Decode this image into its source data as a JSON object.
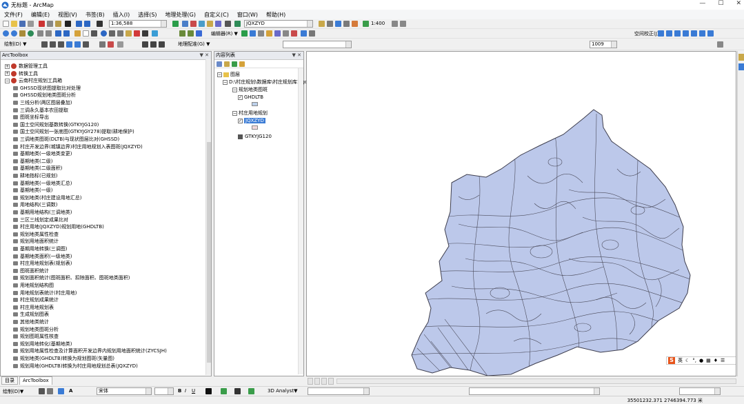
{
  "window": {
    "title": "无标题 - ArcMap",
    "controls": [
      "—",
      "☐",
      "✕"
    ]
  },
  "menu": [
    "文件(F)",
    "编辑(E)",
    "视图(V)",
    "书签(B)",
    "插入(I)",
    "选择(S)",
    "地理处理(G)",
    "自定义(C)",
    "窗口(W)",
    "帮助(H)"
  ],
  "toolbar": {
    "scale": "1:36,588",
    "layer": "JQXZYD",
    "zoom_percent": "1:400",
    "draw_label": "绘制(D) ▼",
    "editor_label": "编辑器(R) ▼",
    "georef_label": "地理配准(G) ▼",
    "spatial_adjust": "空间校正(J) ▼",
    "georef_layer": "",
    "tool_dd": "1009"
  },
  "arctoolbox": {
    "header": "ArcToolbox",
    "items": [
      {
        "level": 0,
        "kind": "toolbox",
        "label": "数据管理工具"
      },
      {
        "level": 0,
        "kind": "toolbox",
        "label": "转换工具"
      },
      {
        "level": 0,
        "kind": "toolbox",
        "label": "云南村庄规划工具箱"
      },
      {
        "level": 1,
        "kind": "tool",
        "label": "GHSSD现状图提取比对处理"
      },
      {
        "level": 1,
        "kind": "tool",
        "label": "GHSSD规划地类图斑分析"
      },
      {
        "level": 1,
        "kind": "tool",
        "label": "三线分析(两区图层叠加)"
      },
      {
        "level": 1,
        "kind": "tool",
        "label": "三调永久基本农田提取"
      },
      {
        "level": 1,
        "kind": "tool",
        "label": "图斑坐标导出"
      },
      {
        "level": 1,
        "kind": "tool",
        "label": "国土空间规划基数转换(GTKYJG120)"
      },
      {
        "level": 1,
        "kind": "tool",
        "label": "国土空间规划一张底图(GTKYJGY278)提取(耕地保护)"
      },
      {
        "level": 1,
        "kind": "tool",
        "label": "三调地类图斑(DLTB)与现状图层比对(GHSSD)"
      },
      {
        "level": 1,
        "kind": "tool",
        "label": "村庄开发边界(城镇边界)村庄用地规划入表图斑(JQXZYD)"
      },
      {
        "level": 1,
        "kind": "tool",
        "label": "基期地类(一级地类变更)"
      },
      {
        "level": 1,
        "kind": "tool",
        "label": "基期地类(二级)"
      },
      {
        "level": 1,
        "kind": "tool",
        "label": "基期地类(二级面积)"
      },
      {
        "level": 1,
        "kind": "tool",
        "label": "耕地指标(已规划)"
      },
      {
        "level": 1,
        "kind": "tool",
        "label": "基期地类(一级地类汇总)"
      },
      {
        "level": 1,
        "kind": "tool",
        "label": "基期地类(一级)"
      },
      {
        "level": 1,
        "kind": "tool",
        "label": "规划地类(村庄建设用地汇总)"
      },
      {
        "level": 1,
        "kind": "tool",
        "label": "用地结构(三调数)"
      },
      {
        "level": 1,
        "kind": "tool",
        "label": "基期用地结构(三调地类)"
      },
      {
        "level": 1,
        "kind": "tool",
        "label": "三区三线划定成果比对"
      },
      {
        "level": 1,
        "kind": "tool",
        "label": "村庄用地(JQXZYD)规划用地(GHDLTB)"
      },
      {
        "level": 1,
        "kind": "tool",
        "label": "规划地类属性检查"
      },
      {
        "level": 1,
        "kind": "tool",
        "label": "规划用地面积统计"
      },
      {
        "level": 1,
        "kind": "tool",
        "label": "基期用地转换(三调图)"
      },
      {
        "level": 1,
        "kind": "tool",
        "label": "基期地类面积(一级地类)"
      },
      {
        "level": 1,
        "kind": "tool",
        "label": "村庄用地规划表(规划表)"
      },
      {
        "level": 1,
        "kind": "tool",
        "label": "图斑面积统计"
      },
      {
        "level": 1,
        "kind": "tool",
        "label": "规划面积统计(图斑面积、扣除面积、图斑地类面积)"
      },
      {
        "level": 1,
        "kind": "tool",
        "label": "用地规划结构图"
      },
      {
        "level": 1,
        "kind": "tool",
        "label": "用地规划表统计(村庄用地)"
      },
      {
        "level": 1,
        "kind": "tool",
        "label": "村庄规划成果统计"
      },
      {
        "level": 1,
        "kind": "tool",
        "label": "村庄用地规划表"
      },
      {
        "level": 1,
        "kind": "tool",
        "label": "生成规划图表"
      },
      {
        "level": 1,
        "kind": "tool",
        "label": "其他地类统计"
      },
      {
        "level": 1,
        "kind": "tool",
        "label": "规划地类图斑分析"
      },
      {
        "level": 1,
        "kind": "tool",
        "label": "规划图斑属性核查"
      },
      {
        "level": 1,
        "kind": "tool",
        "label": "规划用地转化(基期地类)"
      },
      {
        "level": 1,
        "kind": "tool",
        "label": "规划用地属性检查及计算面积开发边界内规划用地面积统计(ZYCSJH)"
      },
      {
        "level": 1,
        "kind": "tool",
        "label": "规划地类(GHDLTB)转换为规划图斑(矢量图)"
      },
      {
        "level": 1,
        "kind": "tool",
        "label": "规划用地(GHDLTB)转换为村庄用地规划总表(JQXZYD)"
      }
    ]
  },
  "toc": {
    "header": "内容列表",
    "layers_root": "图层",
    "gdb": "D:\\村庄规划\\数据库\\村庄规划库1.gdb",
    "group1": "规划地类图斑",
    "layer1": "GHDLTB",
    "group2": "村庄用地规划",
    "layer2": "JQXZYD",
    "layer3": "GTKYJG120"
  },
  "tabs": [
    "目录",
    "ArcToolbox"
  ],
  "bottom": {
    "drawing": "绘制(D)▼",
    "font": "宋体",
    "size": "",
    "analysis": "3D Analyst▼"
  },
  "status": {
    "coords": "35501232.371 2746394.773 米"
  },
  "ime": {
    "label": "英"
  },
  "colors": {
    "polygon_fill": "#bcc8ea",
    "polygon_stroke": "#4a4a5a",
    "selected": "#3a7bd5"
  }
}
